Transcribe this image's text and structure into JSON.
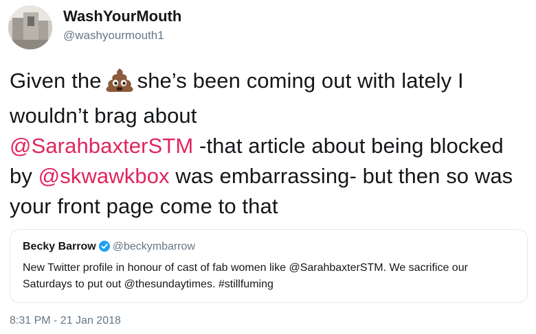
{
  "author": {
    "display_name": "WashYourMouth",
    "handle": "@washyourmouth1"
  },
  "tweet": {
    "text_part1": "Given the",
    "emoji": "pile-of-poo-emoji",
    "text_part2": "she’s been coming out with lately I wouldn’t brag about",
    "mention1": "@SarahbaxterSTM",
    "text_part3": "-that article about being blocked by",
    "mention2": "@skwawkbox",
    "text_part4": "was embarrassing- but then so was your front page come to that"
  },
  "quoted_tweet": {
    "display_name": "Becky Barrow",
    "verified_icon": "verified-badge-icon",
    "handle": "@beckymbarrow",
    "text": "New Twitter profile in honour of cast of fab women like @SarahbaxterSTM. We sacrifice our Saturdays to put out @thesundaytimes. #stillfuming"
  },
  "timestamp": "8:31 PM - 21 Jan 2018",
  "colors": {
    "mention": "#e0245e",
    "verified": "#1da1f2",
    "secondary_text": "#657786",
    "border": "#e1e8ed"
  }
}
